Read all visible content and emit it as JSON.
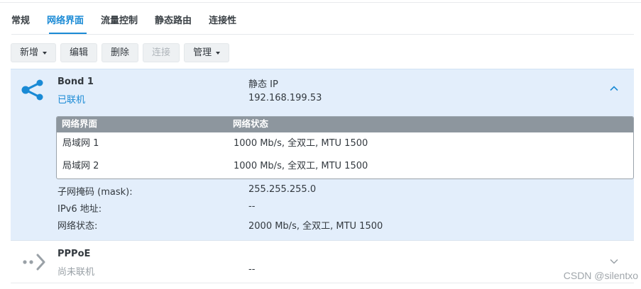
{
  "tabs": [
    {
      "label": "常规"
    },
    {
      "label": "网络界面"
    },
    {
      "label": "流量控制"
    },
    {
      "label": "静态路由"
    },
    {
      "label": "连接性"
    }
  ],
  "toolbar": {
    "new_label": "新增",
    "edit_label": "编辑",
    "delete_label": "删除",
    "connect_label": "连接",
    "manage_label": "管理"
  },
  "bond": {
    "name": "Bond 1",
    "status": "已联机",
    "mode": "静态 IP",
    "ip": "192.168.199.53",
    "table": {
      "headers": [
        "网络界面",
        "网络状态"
      ],
      "rows": [
        {
          "iface": "局域网 1",
          "state": "1000 Mb/s, 全双工, MTU 1500"
        },
        {
          "iface": "局域网 2",
          "state": "1000 Mb/s, 全双工, MTU 1500"
        }
      ]
    },
    "details": {
      "mask_label": "子网掩码 (mask):",
      "mask_value": "255.255.255.0",
      "ipv6_label": "IPv6 地址:",
      "ipv6_value": "--",
      "netstate_label": "网络状态:",
      "netstate_value": "2000 Mb/s, 全双工, MTU 1500"
    },
    "icon": "share-network-icon",
    "accent": "#1a8ad5"
  },
  "pppoe": {
    "name": "PPPoE",
    "status": "尚未联机",
    "ip": "--",
    "icon": "pppoe-arrow-icon"
  },
  "watermark": "CSDN @silentxo"
}
